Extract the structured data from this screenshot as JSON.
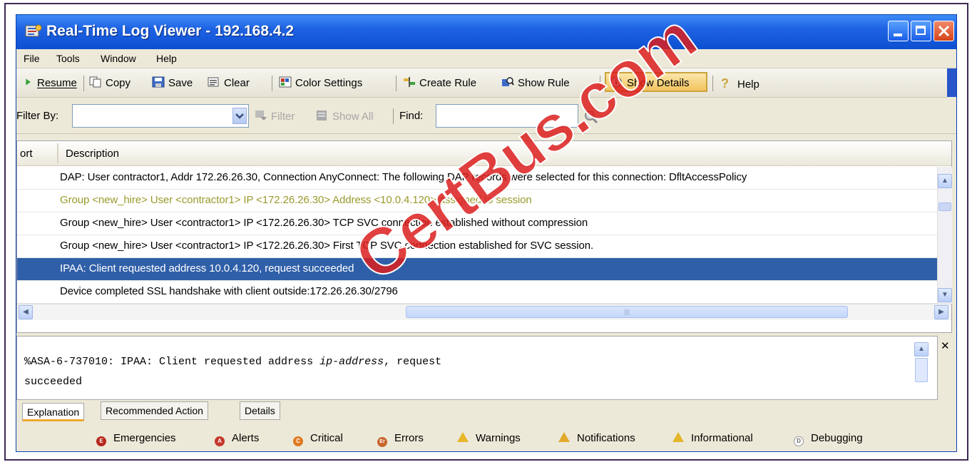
{
  "window": {
    "title": "Real-Time Log Viewer - 192.168.4.2"
  },
  "menu": [
    "File",
    "Tools",
    "Window",
    "Help"
  ],
  "toolbar": {
    "resume": "Resume",
    "copy": "Copy",
    "save": "Save",
    "clear": "Clear",
    "color_settings": "Color Settings",
    "create_rule": "Create Rule",
    "show_rule": "Show Rule",
    "show_details": "Show Details",
    "help": "Help"
  },
  "filterbar": {
    "filter_by_label": "Filter By:",
    "filter_by_value": "",
    "filter_button": "Filter",
    "show_all_button": "Show All",
    "find_label": "Find:",
    "find_value": ""
  },
  "log_table": {
    "columns": [
      "ort",
      "Description"
    ],
    "rows": [
      {
        "description": "DAP: User contractor1, Addr 172.26.26.30, Connection AnyConnect: The following DAP records were selected for this connection: DfltAccessPolicy",
        "color": "#000000",
        "selected": false
      },
      {
        "description": "Group <new_hire> User <contractor1> IP <172.26.26.30> Address <10.0.4.120> assigned to session",
        "color": "#9a9a2e",
        "selected": false
      },
      {
        "description": "Group <new_hire> User <contractor1> IP <172.26.26.30> TCP SVC connection established without compression",
        "color": "#000000",
        "selected": false
      },
      {
        "description": "Group <new_hire> User <contractor1> IP <172.26.26.30> First TCP SVC connection established for SVC session.",
        "color": "#000000",
        "selected": false
      },
      {
        "description": "IPAA: Client requested address 10.0.4.120, request succeeded",
        "color": "#ffffff",
        "selected": true
      },
      {
        "description": "Device completed SSL handshake with client outside:172.26.26.30/2796",
        "color": "#000000",
        "selected": false
      }
    ]
  },
  "detail": {
    "line1_prefix": "%ASA-6-737010: IPAA: Client requested address ",
    "line1_italic": "ip-address",
    "line1_suffix": ", request",
    "line2": "succeeded"
  },
  "tabs": [
    "Explanation",
    "Recommended Action",
    "Details"
  ],
  "levels": [
    {
      "label": "Emergencies",
      "badge": "E",
      "color": "#b8281e",
      "shape": "circle"
    },
    {
      "label": "Alerts",
      "badge": "A",
      "color": "#c4372c",
      "shape": "circle"
    },
    {
      "label": "Critical",
      "badge": "C",
      "color": "#e07a22",
      "shape": "circle"
    },
    {
      "label": "Errors",
      "badge": "Er",
      "color": "#c8662e",
      "shape": "circle"
    },
    {
      "label": "Warnings",
      "badge": "!",
      "color": "#e8b62a",
      "shape": "triangle"
    },
    {
      "label": "Notifications",
      "badge": "N",
      "color": "#e3a92a",
      "shape": "triangle"
    },
    {
      "label": "Informational",
      "badge": "i",
      "color": "#e3b62a",
      "shape": "triangle"
    },
    {
      "label": "Debugging",
      "badge": "D",
      "color": "#bbbbbb",
      "shape": "circle-outline"
    }
  ],
  "watermark": "CertBus.com"
}
